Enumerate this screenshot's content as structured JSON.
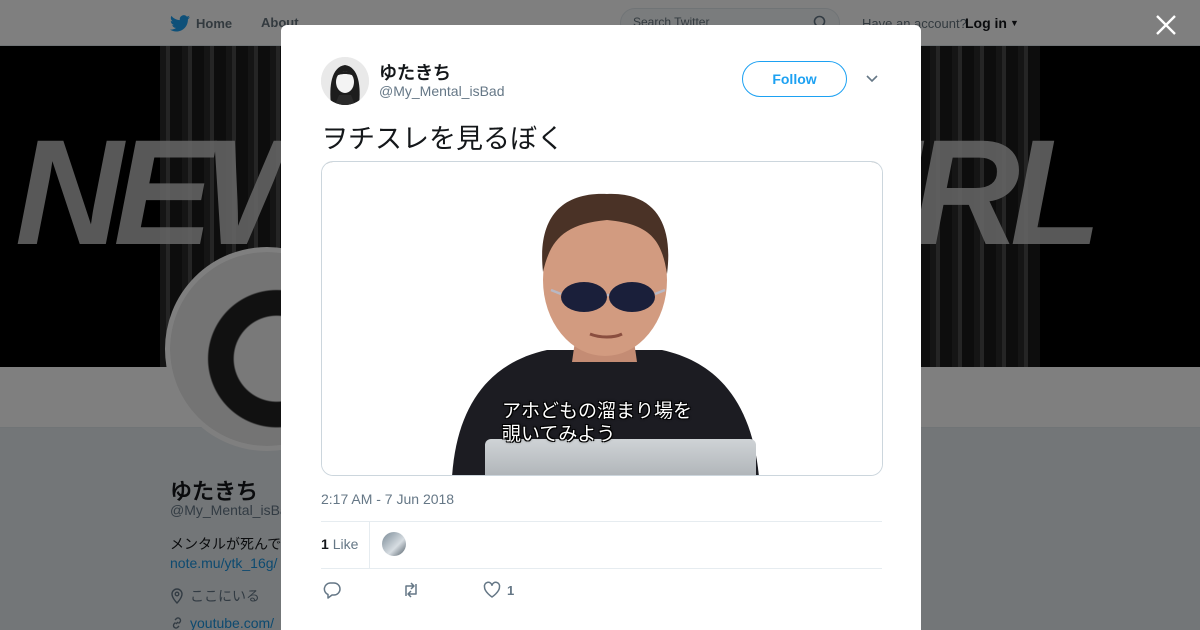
{
  "header": {
    "home_label": "Home",
    "about_label": "About",
    "search_placeholder": "Search Twitter",
    "have_account": "Have an account?",
    "login_label": "Log in"
  },
  "background_profile": {
    "banner_text_left": "NEW",
    "banner_text_right": "IRL",
    "display_name": "ゆたきち",
    "handle": "@My_Mental_isBa",
    "bio": "メンタルが死んで",
    "link1": "note.mu/ytk_16g/",
    "location": "ここにいる",
    "link2": "youtube.com/"
  },
  "tweet": {
    "display_name": "ゆたきち",
    "handle": "@My_Mental_isBad",
    "follow_label": "Follow",
    "text": "ヲチスレを見るぼく",
    "media_subtitle_line1": "アホどもの溜まり場を",
    "media_subtitle_line2": "覗いてみよう",
    "timestamp": "2:17 AM - 7 Jun 2018",
    "like_count": "1",
    "like_label": "Like",
    "action_like_count": "1"
  },
  "colors": {
    "brand": "#1da1f2",
    "text": "#14171a",
    "muted": "#657786"
  }
}
